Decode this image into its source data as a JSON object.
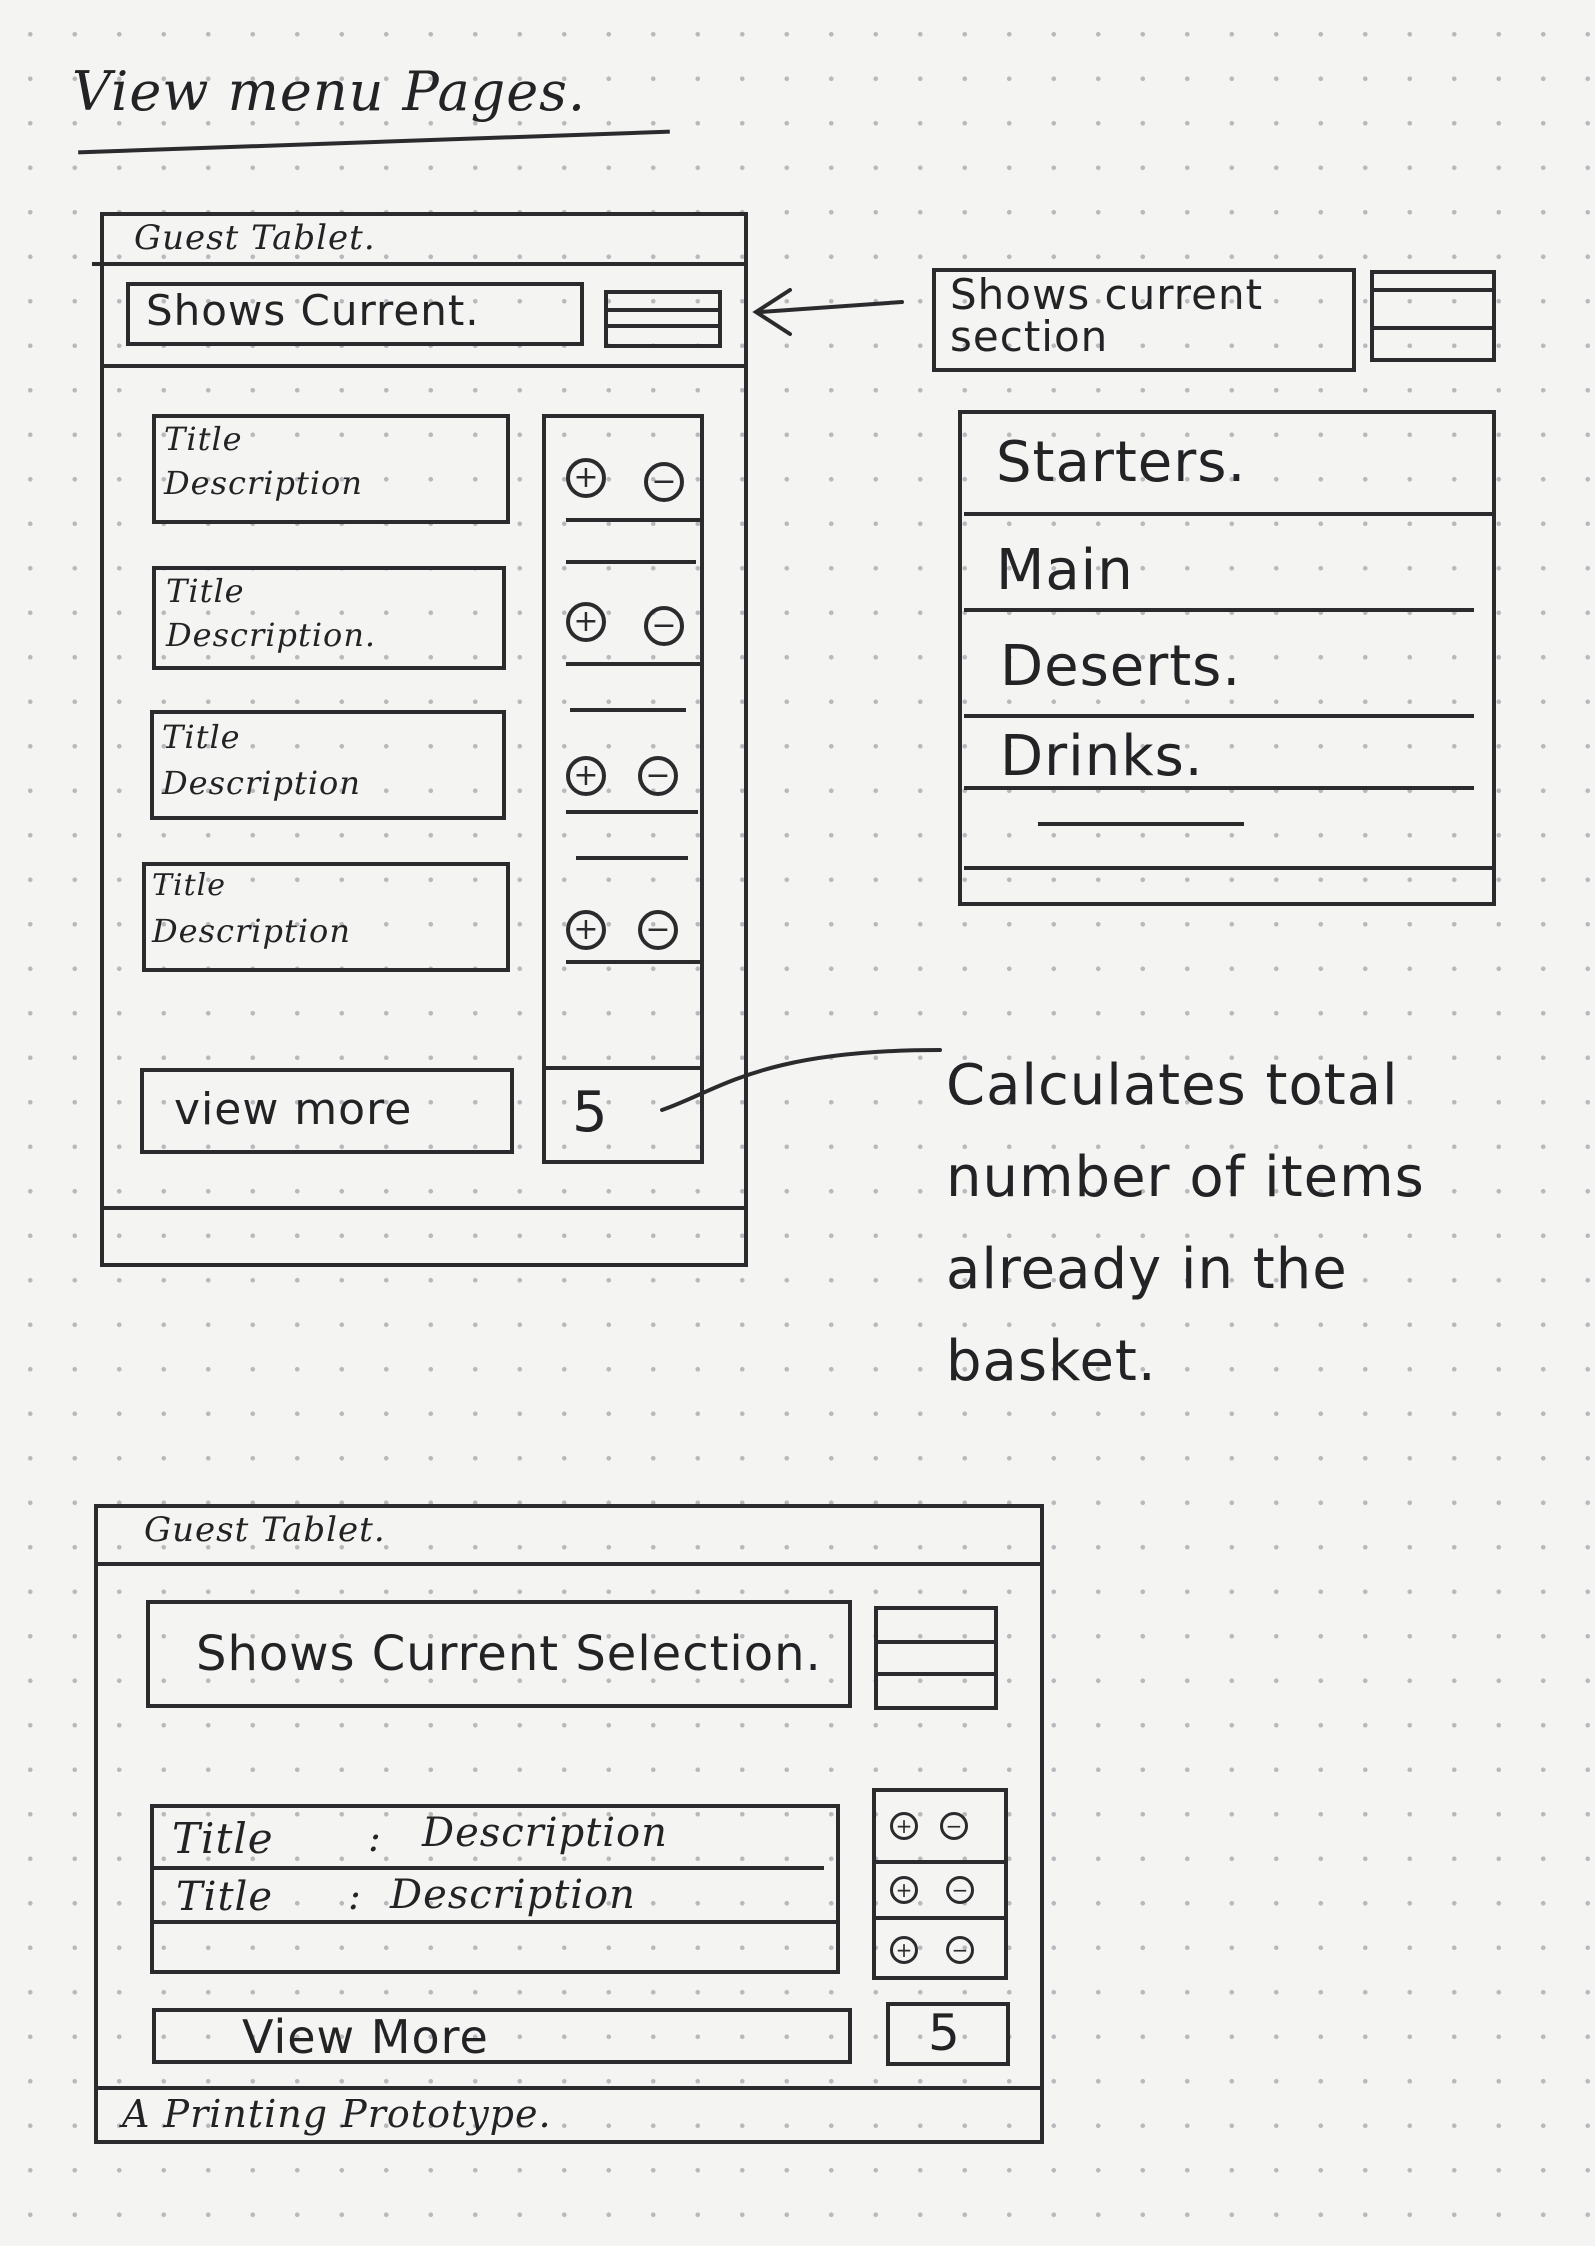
{
  "title": "View menu Pages.",
  "wireframe1": {
    "window_label": "Guest Tablet.",
    "header_text": "Shows Current.",
    "menu_items": [
      {
        "title": "Title",
        "description": "Description"
      },
      {
        "title": "Title",
        "description": "Description."
      },
      {
        "title": "Title",
        "description": "Description"
      },
      {
        "title": "Title",
        "description": "Description"
      }
    ],
    "plus_symbol": "+",
    "minus_symbol": "−",
    "view_more": "view more",
    "basket_count": "5"
  },
  "section_panel": {
    "header_text": "Shows current section",
    "sections": [
      "Starters.",
      "Main",
      "Deserts.",
      "Drinks."
    ]
  },
  "annotation": "Calculates total number of items already in the basket.",
  "wireframe2": {
    "window_label": "Guest Tablet.",
    "header_text": "Shows Current Selection.",
    "menu_items": [
      {
        "title": "Title",
        "separator": ":",
        "description": "Description"
      },
      {
        "title": "Title",
        "separator": ":",
        "description": "Description"
      }
    ],
    "view_more": "View More",
    "basket_count": "5",
    "footer_text": "A Printing Prototype."
  },
  "icons": {
    "hamburger": "hamburger-menu-icon",
    "plus": "plus-circle-icon",
    "minus": "minus-circle-icon",
    "arrow": "arrow-left-icon"
  },
  "colors": {
    "ink": "#2b2b2e",
    "paper": "#f4f4f2",
    "dots": "#b9b9bd"
  }
}
